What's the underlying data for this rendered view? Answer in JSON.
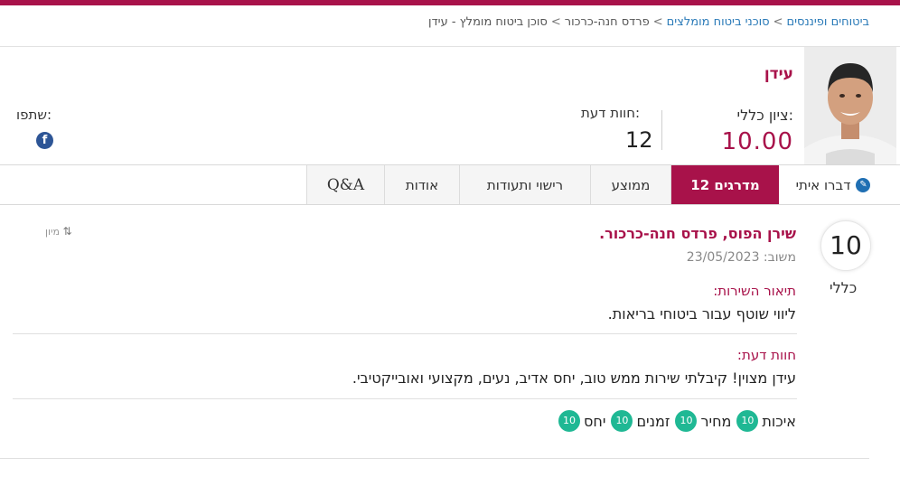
{
  "breadcrumb": {
    "items": [
      "ביטוחים ופיננסים",
      "סוכני ביטוח מומלצים",
      "פרדס חנה-כרכור",
      "סוכן ביטוח מומלץ - עידן"
    ],
    "separator": ">"
  },
  "profile": {
    "name": "עידן",
    "overall_score_label": "ציון כללי:",
    "overall_score_value": "10.00",
    "reviews_label": "חוות דעת:",
    "reviews_count": "12"
  },
  "share": {
    "label": "שתפו:",
    "facebook_glyph": "f",
    "facebook_color": "#2d5596"
  },
  "tabs": {
    "talk": "דברו איתי",
    "raters": "12 מדרגים",
    "average": "ממוצע",
    "licenses": "רישוי ותעודות",
    "about": "אודות",
    "qa": "Q&A"
  },
  "sort": {
    "label": "מיון",
    "icon": "sort-arrows-icon"
  },
  "review": {
    "score": "10",
    "score_caption": "כללי",
    "reviewer": "שירן הפוס, פרדס חנה-כרכור.",
    "date": "משוב: 23/05/2023",
    "service_title": "תיאור השירות:",
    "service_text": "ליווי שוטף עבור ביטוחי בריאות.",
    "opinion_title": "חוות דעת:",
    "opinion_text": "עידן מצוין! קיבלתי שירות ממש טוב, יחס אדיב, נעים, מקצועי ואובייקטיבי.",
    "ratings": [
      {
        "label": "איכות",
        "value": "10"
      },
      {
        "label": "מחיר",
        "value": "10"
      },
      {
        "label": "זמנים",
        "value": "10"
      },
      {
        "label": "יחס",
        "value": "10"
      }
    ]
  },
  "colors": {
    "brand": "#a8124a",
    "rating_badge": "#1fb894",
    "link": "#2a7ab8"
  }
}
